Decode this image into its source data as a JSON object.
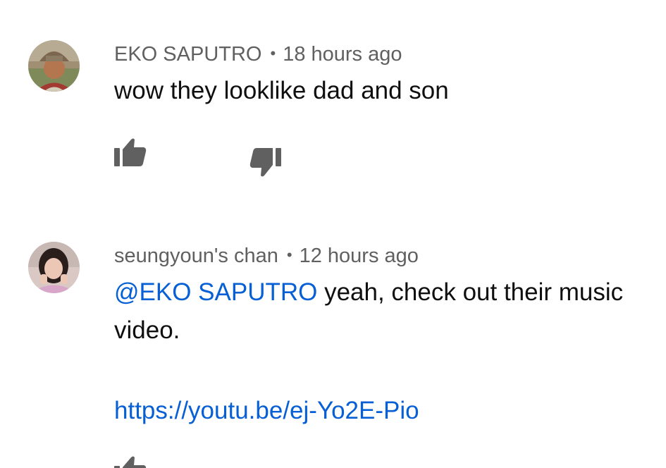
{
  "comments": [
    {
      "author": "EKO SAPUTRO",
      "time": "18 hours ago",
      "text": "wow they looklike dad and son"
    },
    {
      "author": "seungyoun's chan",
      "time": "12 hours ago",
      "mention": "@EKO SAPUTRO",
      "text": " yeah, check out their music video.",
      "link": "https://youtu.be/ej-Yo2E-Pio"
    }
  ],
  "separator": "•",
  "icons": {
    "like": "thumb-up-icon",
    "dislike": "thumb-down-icon"
  },
  "colors": {
    "link": "#065fd4",
    "meta": "#606060",
    "text": "#0f0f0f",
    "icon": "#606060"
  }
}
